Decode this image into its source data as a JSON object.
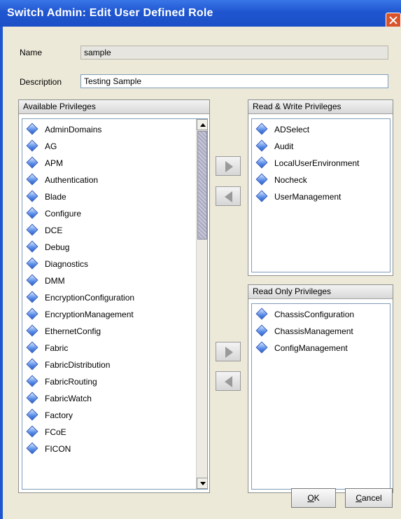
{
  "window": {
    "title": "Switch Admin: Edit User Defined Role"
  },
  "form": {
    "name_label": "Name",
    "name_value": "sample",
    "description_label": "Description",
    "description_value": "Testing Sample"
  },
  "available": {
    "title": "Available Privileges",
    "items": [
      "AdminDomains",
      "AG",
      "APM",
      "Authentication",
      "Blade",
      "Configure",
      "DCE",
      "Debug",
      "Diagnostics",
      "DMM",
      "EncryptionConfiguration",
      "EncryptionManagement",
      "EthernetConfig",
      "Fabric",
      "FabricDistribution",
      "FabricRouting",
      "FabricWatch",
      "Factory",
      "FCoE",
      "FICON"
    ]
  },
  "read_write": {
    "title": "Read & Write Privileges",
    "items": [
      "ADSelect",
      "Audit",
      "LocalUserEnvironment",
      "Nocheck",
      "UserManagement"
    ]
  },
  "read_only": {
    "title": "Read Only Privileges",
    "items": [
      "ChassisConfiguration",
      "ChassisManagement",
      "ConfigManagement"
    ]
  },
  "buttons": {
    "ok_mnemonic": "O",
    "ok_rest": "K",
    "cancel_mnemonic": "C",
    "cancel_rest": "ancel"
  },
  "icons": {
    "item": "diamond-privilege-icon",
    "close": "close-icon"
  },
  "colors": {
    "titlebar": "#1f56d0",
    "dialog_bg": "#ece9d8"
  }
}
